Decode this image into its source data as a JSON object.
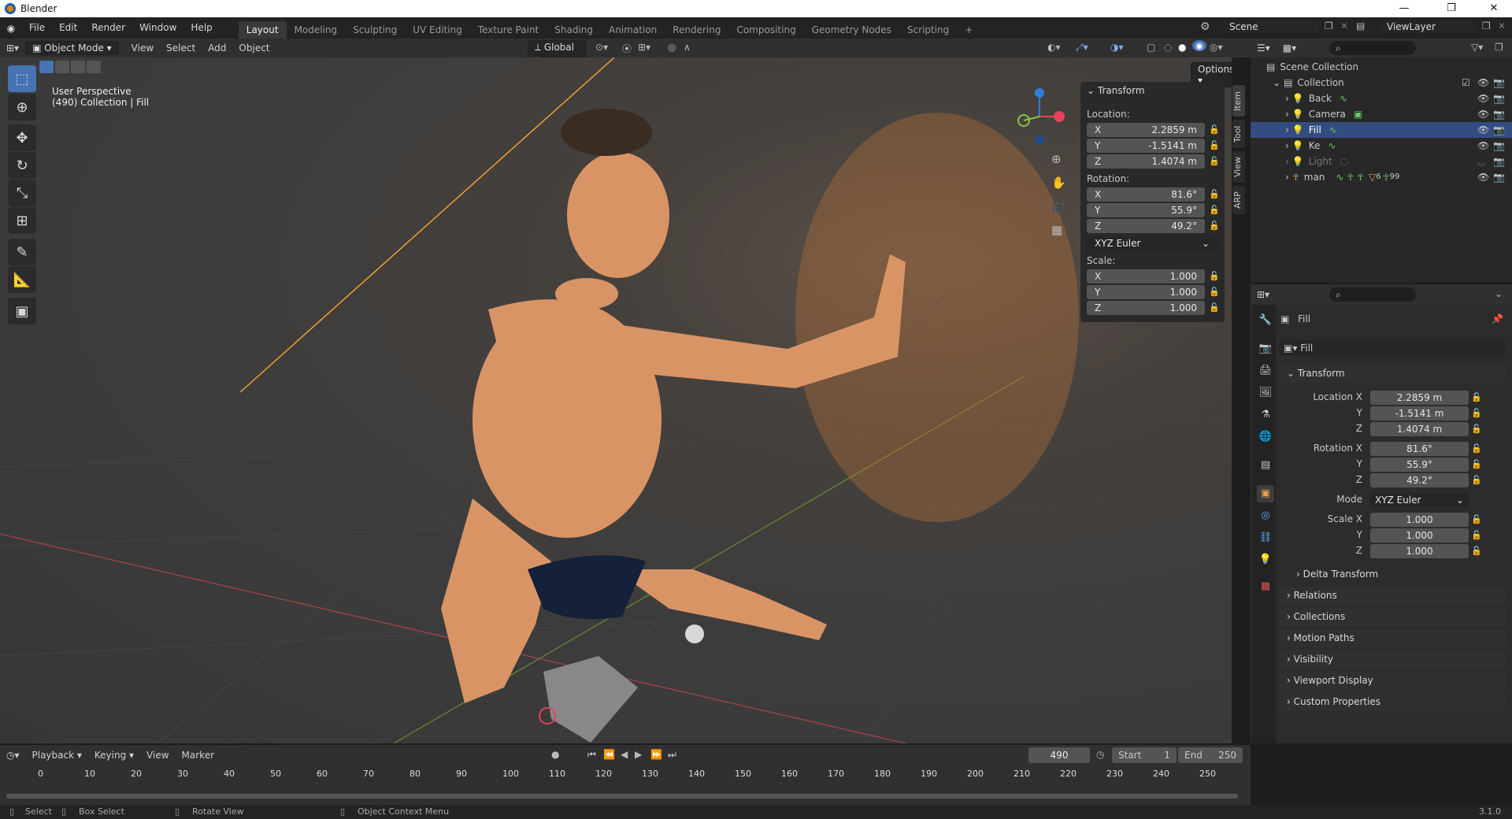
{
  "app": {
    "title": "Blender",
    "version": "3.1.0"
  },
  "menu": [
    "File",
    "Edit",
    "Render",
    "Window",
    "Help"
  ],
  "workspaces": [
    "Layout",
    "Modeling",
    "Sculpting",
    "UV Editing",
    "Texture Paint",
    "Shading",
    "Animation",
    "Rendering",
    "Compositing",
    "Geometry Nodes",
    "Scripting",
    "+"
  ],
  "scene": {
    "name": "Scene",
    "view_layer": "ViewLayer"
  },
  "viewport_header": {
    "mode": "Object Mode",
    "menus": [
      "View",
      "Select",
      "Add",
      "Object"
    ],
    "orientation": "Global",
    "options": "Options"
  },
  "overlay_text": {
    "perspective": "User Perspective",
    "collection": "(490) Collection | Fill"
  },
  "tools": [
    "select-box",
    "cursor",
    "move",
    "rotate",
    "scale",
    "transform",
    "annotate",
    "measure",
    "add-cube"
  ],
  "sidebar_tabs": [
    "Item",
    "Tool",
    "View",
    "ARP"
  ],
  "npanel": {
    "title": "Transform",
    "location_label": "Location:",
    "rotation_label": "Rotation:",
    "scale_label": "Scale:",
    "axes": [
      "X",
      "Y",
      "Z"
    ],
    "location": [
      "2.2859 m",
      "-1.5141 m",
      "1.4074 m"
    ],
    "rotation": [
      "81.6°",
      "55.9°",
      "49.2°"
    ],
    "mode": "XYZ Euler",
    "scale": [
      "1.000",
      "1.000",
      "1.000"
    ]
  },
  "outliner": {
    "root": "Scene Collection",
    "collection": "Collection",
    "items": [
      {
        "name": "Back",
        "selected": false,
        "disabled": false
      },
      {
        "name": "Camera",
        "selected": false,
        "disabled": false
      },
      {
        "name": "Fill",
        "selected": true,
        "disabled": false
      },
      {
        "name": "Ke",
        "selected": false,
        "disabled": false
      },
      {
        "name": "Light",
        "selected": false,
        "disabled": true
      },
      {
        "name": "man",
        "selected": false,
        "disabled": false
      }
    ],
    "man_badges": [
      "6",
      "99"
    ]
  },
  "properties": {
    "object_name": "Fill",
    "data_name": "Fill",
    "section": "Transform",
    "location_label": "Location X",
    "rotation_label": "Rotation X",
    "scale_label": "Scale X",
    "y_label": "Y",
    "z_label": "Z",
    "mode_label": "Mode",
    "location": [
      "2.2859 m",
      "-1.5141 m",
      "1.4074 m"
    ],
    "rotation": [
      "81.6°",
      "55.9°",
      "49.2°"
    ],
    "mode": "XYZ Euler",
    "scale": [
      "1.000",
      "1.000",
      "1.000"
    ],
    "sections": [
      "Delta Transform",
      "Relations",
      "Collections",
      "Motion Paths",
      "Visibility",
      "Viewport Display",
      "Custom Properties"
    ]
  },
  "timeline": {
    "menus": [
      "Playback",
      "Keying",
      "View",
      "Marker"
    ],
    "current_frame": "490",
    "start_label": "Start",
    "start": "1",
    "end_label": "End",
    "end": "250",
    "ticks": [
      "0",
      "10",
      "20",
      "30",
      "40",
      "50",
      "60",
      "70",
      "80",
      "90",
      "100",
      "110",
      "120",
      "130",
      "140",
      "150",
      "160",
      "170",
      "180",
      "190",
      "200",
      "210",
      "220",
      "230",
      "240",
      "250"
    ]
  },
  "status": {
    "select": "Select",
    "box_select": "Box Select",
    "rotate": "Rotate View",
    "context": "Object Context Menu"
  },
  "colors": {
    "accent": "#4772b3",
    "active_tool": "#4772b3",
    "selection_row": "#334d80",
    "x_axis": "#e8415a",
    "y_axis": "#8bc34a",
    "z_axis": "#2f7ed8",
    "light_line": "#f0a030"
  }
}
